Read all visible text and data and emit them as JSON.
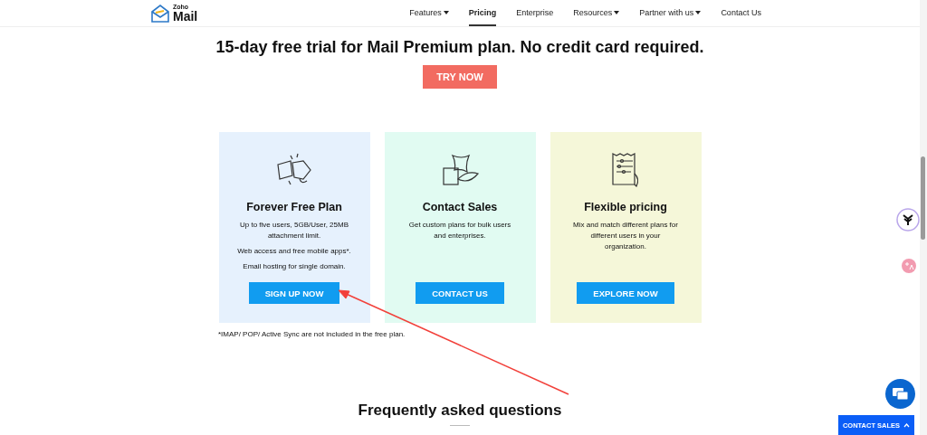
{
  "header": {
    "logo": {
      "brand": "Zoho",
      "product": "Mail"
    },
    "nav": [
      {
        "label": "Features",
        "dropdown": true,
        "selected": false
      },
      {
        "label": "Pricing",
        "dropdown": false,
        "selected": true
      },
      {
        "label": "Enterprise",
        "dropdown": false,
        "selected": false
      },
      {
        "label": "Resources",
        "dropdown": true,
        "selected": false
      },
      {
        "label": "Partner with us",
        "dropdown": true,
        "selected": false
      },
      {
        "label": "Contact Us",
        "dropdown": false,
        "selected": false
      }
    ]
  },
  "trial": {
    "title": "15-day free trial for Mail Premium plan. No credit card required.",
    "button": "TRY NOW"
  },
  "cards": [
    {
      "kind": "free",
      "title": "Forever Free Plan",
      "lines": [
        "Up to five users, 5GB/User, 25MB attachment limit.",
        "Web access and free mobile apps*.",
        "Email hosting for single domain."
      ],
      "button": "SIGN UP NOW",
      "color": "#e6f1fd"
    },
    {
      "kind": "sales",
      "title": "Contact Sales",
      "lines": [
        "Get custom plans for bulk users and enterprises."
      ],
      "button": "CONTACT US",
      "color": "#e1fbf2"
    },
    {
      "kind": "flexible",
      "title": "Flexible pricing",
      "lines": [
        "Mix and match different plans for different users in your organization."
      ],
      "button": "EXPLORE NOW",
      "color": "#f5f7d9"
    }
  ],
  "footnote": "*IMAP/ POP/ Active Sync are not included in the free plan.",
  "faq": {
    "title": "Frequently asked questions"
  },
  "contact_sales": {
    "label": "CONTACT SALES"
  }
}
